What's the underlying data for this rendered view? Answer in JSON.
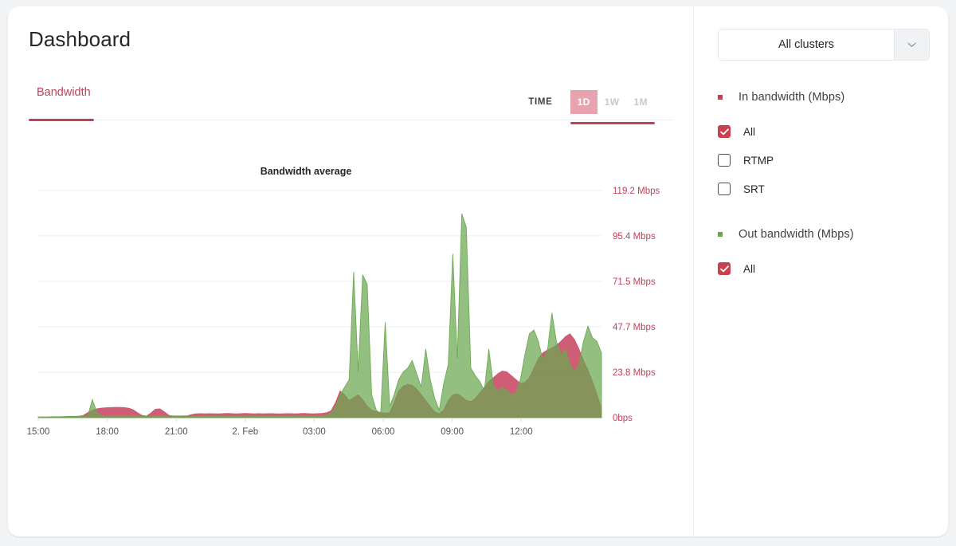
{
  "header": {
    "title": "Dashboard"
  },
  "tabs": [
    {
      "label": "Bandwidth",
      "active": true
    }
  ],
  "time_selector": {
    "label": "TIME",
    "options": [
      {
        "label": "1D",
        "active": true
      },
      {
        "label": "1W",
        "active": false
      },
      {
        "label": "1M",
        "active": false
      }
    ]
  },
  "sidebar": {
    "cluster_select": {
      "value": "All clusters",
      "caret_icon": "chevron-down-icon"
    },
    "groups": [
      {
        "legend_label": "In bandwidth (Mbps)",
        "legend_color": "#c2415a",
        "items": [
          {
            "label": "All",
            "checked": true
          },
          {
            "label": "RTMP",
            "checked": false
          },
          {
            "label": "SRT",
            "checked": false
          }
        ]
      },
      {
        "legend_label": "Out bandwidth (Mbps)",
        "legend_color": "#6aa84f",
        "items": [
          {
            "label": "All",
            "checked": true
          }
        ]
      }
    ]
  },
  "colors": {
    "accent_red": "#c2415a",
    "in_bandwidth": "#cc4f6a",
    "out_bandwidth": "#6aa84f",
    "checkbox_checked": "#c9414f",
    "range_active_bg": "#e8a3ae",
    "card_bg": "#ffffff",
    "page_bg": "#f3f4f6",
    "gridline": "#ededf0"
  },
  "chart_data": {
    "type": "area",
    "title": "Bandwidth average",
    "xlabel": "",
    "ylabel": "",
    "grid": true,
    "legend_position": "right-sidebar",
    "ylim": [
      0,
      119.2
    ],
    "ytick_values": [
      0,
      23.8,
      47.7,
      71.5,
      95.4,
      119.2
    ],
    "ytick_labels": [
      "0bps",
      "23.8 Mbps",
      "47.7 Mbps",
      "71.5 Mbps",
      "95.4 Mbps",
      "119.2 Mbps"
    ],
    "xtick_labels": [
      "15:00",
      "18:00",
      "21:00",
      "2. Feb",
      "03:00",
      "06:00",
      "09:00",
      "12:00"
    ],
    "xtick_positions": [
      0.0,
      0.1225,
      0.245,
      0.3675,
      0.49,
      0.6125,
      0.735,
      0.8575
    ],
    "x": [
      0.0,
      0.008,
      0.016,
      0.024,
      0.032,
      0.04,
      0.048,
      0.056,
      0.064,
      0.072,
      0.08,
      0.088,
      0.096,
      0.104,
      0.112,
      0.12,
      0.128,
      0.136,
      0.144,
      0.152,
      0.16,
      0.168,
      0.176,
      0.184,
      0.192,
      0.2,
      0.208,
      0.216,
      0.224,
      0.232,
      0.24,
      0.248,
      0.256,
      0.264,
      0.272,
      0.28,
      0.288,
      0.296,
      0.304,
      0.312,
      0.32,
      0.328,
      0.336,
      0.344,
      0.352,
      0.36,
      0.368,
      0.376,
      0.384,
      0.392,
      0.4,
      0.408,
      0.416,
      0.424,
      0.432,
      0.44,
      0.448,
      0.456,
      0.464,
      0.472,
      0.48,
      0.488,
      0.496,
      0.504,
      0.512,
      0.52,
      0.528,
      0.536,
      0.544,
      0.552,
      0.56,
      0.568,
      0.576,
      0.584,
      0.592,
      0.6,
      0.608,
      0.616,
      0.624,
      0.632,
      0.64,
      0.648,
      0.656,
      0.664,
      0.672,
      0.68,
      0.688,
      0.696,
      0.704,
      0.712,
      0.72,
      0.728,
      0.736,
      0.744,
      0.752,
      0.76,
      0.768,
      0.776,
      0.784,
      0.792,
      0.8,
      0.808,
      0.816,
      0.824,
      0.832,
      0.84,
      0.848,
      0.856,
      0.864,
      0.872,
      0.88,
      0.888,
      0.896,
      0.904,
      0.912,
      0.92,
      0.928,
      0.936,
      0.944,
      0.952,
      0.96,
      0.968,
      0.976,
      0.984,
      0.992,
      1.0
    ],
    "series": [
      {
        "name": "In bandwidth (Mbps)",
        "color": "#cc4f6a",
        "values": [
          0.3,
          0.3,
          0.3,
          0.4,
          0.4,
          0.4,
          0.5,
          0.6,
          0.6,
          0.7,
          1.2,
          2.6,
          3.8,
          4.6,
          5.0,
          5.2,
          5.3,
          5.4,
          5.4,
          5.3,
          5.0,
          4.2,
          2.6,
          1.2,
          0.8,
          2.4,
          4.4,
          4.6,
          3.0,
          1.2,
          0.8,
          0.8,
          0.9,
          0.9,
          1.6,
          2.0,
          2.1,
          2.0,
          2.1,
          2.0,
          2.0,
          2.1,
          2.2,
          2.1,
          2.0,
          2.1,
          2.2,
          2.1,
          2.0,
          2.1,
          2.0,
          2.1,
          2.1,
          2.0,
          2.0,
          2.1,
          2.1,
          2.0,
          2.1,
          2.2,
          2.1,
          2.0,
          2.1,
          2.2,
          2.6,
          3.6,
          8.0,
          14.0,
          12.0,
          9.0,
          10.5,
          12.0,
          9.5,
          6.0,
          4.0,
          3.2,
          2.8,
          2.4,
          2.6,
          8.0,
          14.0,
          16.5,
          17.5,
          17.0,
          15.0,
          12.0,
          9.0,
          6.0,
          3.0,
          2.2,
          4.0,
          9.0,
          12.0,
          12.5,
          11.0,
          9.0,
          8.5,
          10.0,
          13.0,
          16.0,
          19.0,
          21.0,
          23.0,
          24.5,
          24.0,
          22.0,
          20.0,
          18.0,
          18.5,
          21.0,
          26.0,
          31.0,
          34.0,
          35.5,
          36.5,
          38.0,
          40.0,
          42.5,
          44.0,
          41.0,
          36.0,
          30.0,
          25.0,
          19.0,
          12.0,
          5.0
        ]
      },
      {
        "name": "Out bandwidth (Mbps)",
        "color": "#6aa84f",
        "values": [
          0.4,
          0.4,
          0.4,
          0.5,
          0.5,
          0.5,
          0.6,
          0.7,
          0.7,
          0.8,
          0.9,
          1.0,
          9.5,
          3.0,
          1.1,
          1.0,
          1.0,
          1.0,
          1.0,
          1.0,
          1.0,
          1.0,
          1.0,
          0.9,
          0.9,
          0.9,
          0.9,
          0.9,
          0.9,
          0.9,
          0.9,
          0.9,
          0.9,
          0.9,
          0.9,
          0.9,
          0.9,
          0.9,
          0.9,
          0.9,
          0.9,
          0.9,
          0.9,
          0.9,
          0.9,
          0.9,
          0.9,
          0.9,
          0.9,
          0.9,
          0.9,
          0.9,
          0.9,
          0.9,
          0.9,
          0.9,
          0.9,
          0.9,
          0.9,
          0.9,
          0.9,
          0.9,
          0.9,
          1.0,
          1.4,
          2.4,
          6.0,
          12.0,
          16.0,
          20.0,
          76.5,
          24.0,
          75.0,
          70.0,
          12.0,
          4.0,
          2.0,
          50.0,
          6.0,
          12.0,
          20.0,
          24.0,
          26.0,
          30.0,
          23.0,
          16.0,
          36.0,
          20.0,
          10.0,
          4.0,
          18.0,
          28.0,
          86.0,
          31.0,
          107.0,
          100.0,
          26.0,
          22.0,
          19.0,
          14.0,
          36.0,
          17.0,
          14.0,
          16.0,
          14.0,
          12.0,
          13.0,
          20.0,
          33.0,
          44.0,
          46.0,
          40.0,
          30.0,
          35.0,
          55.0,
          40.0,
          33.0,
          36.0,
          28.0,
          24.0,
          28.0,
          40.0,
          48.0,
          42.0,
          40.0,
          34.0
        ]
      }
    ]
  }
}
